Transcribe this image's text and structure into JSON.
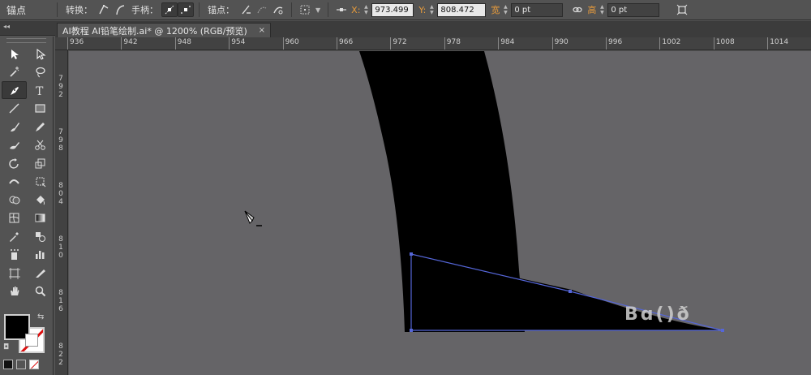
{
  "control_bar": {
    "title": "锚点",
    "convert_label": "转换：",
    "handles_label": "手柄：",
    "anchors_label": "锚点：",
    "x_label": "X:",
    "x_value": "973.499",
    "y_label": "Y:",
    "y_value": "808.472",
    "width_label": "宽",
    "width_value": "0 pt",
    "height_label": "高",
    "height_value": "0 pt"
  },
  "tabs": {
    "panel_head": "◂◂",
    "document_tab": "AI教程 AI铅笔绘制.ai* @ 1200% (RGB/预览)",
    "close": "×"
  },
  "ruler": {
    "top_ticks": [
      "936",
      "942",
      "948",
      "954",
      "960",
      "966",
      "972",
      "978",
      "984",
      "990",
      "996",
      "1002",
      "1008",
      "1014"
    ],
    "left_ticks": [
      "792",
      "798",
      "804",
      "810",
      "816",
      "822"
    ]
  },
  "toolbox": {
    "tools": [
      [
        "selection-tool-icon",
        "direct-selection-tool-icon"
      ],
      [
        "magic-wand-tool-icon",
        "lasso-tool-icon"
      ],
      [
        "pen-tool-icon",
        "type-tool-icon"
      ],
      [
        "line-segment-tool-icon",
        "rectangle-tool-icon"
      ],
      [
        "paintbrush-tool-icon",
        "pencil-tool-icon"
      ],
      [
        "blob-brush-tool-icon",
        "scissors-tool-icon"
      ],
      [
        "rotate-tool-icon",
        "scale-tool-icon"
      ],
      [
        "width-tool-icon",
        "free-transform-tool-icon"
      ],
      [
        "shape-builder-tool-icon",
        "live-paint-bucket-tool-icon"
      ],
      [
        "mesh-tool-icon",
        "gradient-tool-icon"
      ],
      [
        "eyedropper-tool-icon",
        "blend-tool-icon"
      ],
      [
        "symbol-sprayer-tool-icon",
        "column-graph-tool-icon"
      ],
      [
        "artboard-tool-icon",
        "slice-tool-icon"
      ],
      [
        "hand-tool-icon",
        "zoom-tool-icon"
      ]
    ],
    "fill_color": "#000000",
    "stroke_color": "none"
  },
  "canvas": {
    "background": "#656467",
    "overlay_text": "Bɑ()ð"
  }
}
